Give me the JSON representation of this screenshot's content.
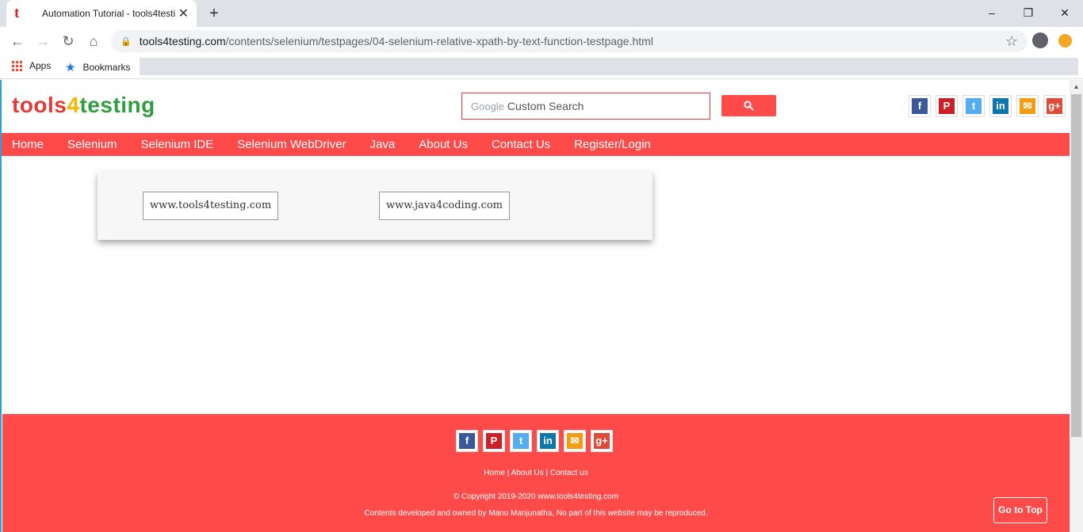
{
  "browser": {
    "tab_title": "Automation Tutorial - tools4testi",
    "tab_favicon": "t",
    "new_tab": "+",
    "url_host": "tools4testing.com",
    "url_path": "/contents/selenium/testpages/04-selenium-relative-xpath-by-text-function-testpage.html",
    "win_minimize": "–",
    "win_restore": "❐",
    "win_close": "✕",
    "back": "←",
    "forward": "→",
    "reload": "↻",
    "home": "⌂",
    "star": "☆",
    "bookmarks": {
      "apps": "Apps",
      "bookmarks": "Bookmarks"
    }
  },
  "site": {
    "logo": {
      "part1": "tools",
      "bolt": "4",
      "part2": "testing"
    },
    "search": {
      "brand": "Google",
      "placeholder": "Custom Search"
    },
    "social": [
      {
        "name": "facebook",
        "glyph": "f",
        "color": "#3b5998"
      },
      {
        "name": "pinterest",
        "glyph": "P",
        "color": "#cb2027"
      },
      {
        "name": "twitter",
        "glyph": "t",
        "color": "#55acee"
      },
      {
        "name": "linkedin",
        "glyph": "in",
        "color": "#0e76a8"
      },
      {
        "name": "email",
        "glyph": "✉",
        "color": "#f39c12"
      },
      {
        "name": "google-plus",
        "glyph": "g+",
        "color": "#dd4b39"
      }
    ],
    "nav": [
      "Home",
      "Selenium",
      "Selenium IDE",
      "Selenium WebDriver",
      "Java",
      "About Us",
      "Contact Us",
      "Register/Login"
    ],
    "links": [
      "www.tools4testing.com",
      "www.java4coding.com"
    ],
    "footer": {
      "links": [
        "Home",
        "About Us",
        "Contact us"
      ],
      "copyright": "© Copyright 2019-2020 www.tools4testing.com",
      "contents": "Contents developed and owned by Manu Manjunatha, No part of this website may be reproduced.",
      "go_top": "Go to Top"
    }
  }
}
